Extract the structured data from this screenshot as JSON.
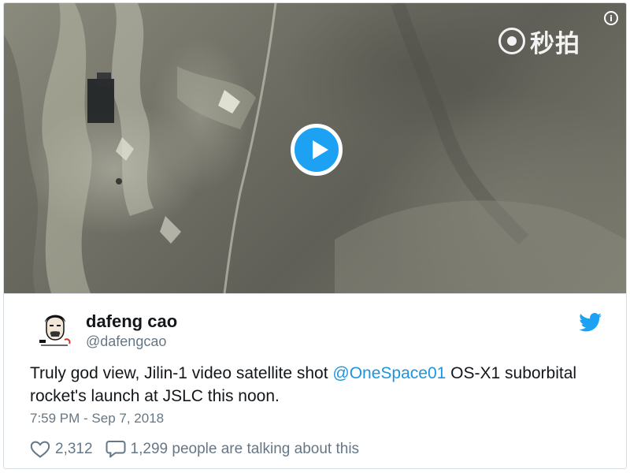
{
  "video": {
    "watermark_text": "秒拍",
    "watermark_icon": "miaopai-logo-icon",
    "info_icon": "info-icon",
    "info_glyph": "i",
    "play_icon": "play-icon"
  },
  "author": {
    "display_name": "dafeng cao",
    "handle": "@dafengcao",
    "avatar_icon": "avatar-illustration"
  },
  "brand": {
    "icon": "twitter-bird-icon",
    "color": "#1da1f2"
  },
  "tweet": {
    "text_before": "Truly god view, Jilin-1 video satellite shot ",
    "mention": "@OneSpace01",
    "text_after": " OS-X1 suborbital rocket's launch at JSLC this noon.",
    "mention_color": "#1b95e0",
    "timestamp": "7:59 PM - Sep 7, 2018"
  },
  "actions": {
    "likes": "2,312",
    "like_icon": "heart-icon",
    "replies_text": "1,299 people are talking about this",
    "reply_icon": "speech-bubble-icon"
  }
}
